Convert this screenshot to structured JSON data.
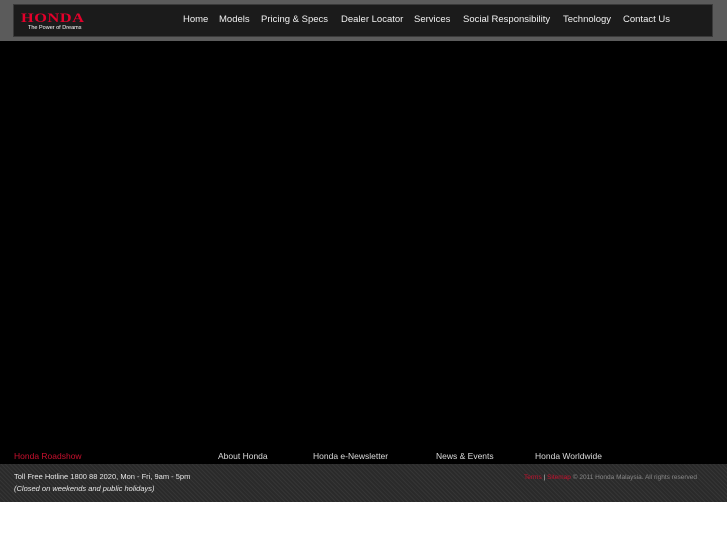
{
  "brand": {
    "name": "HONDA",
    "tagline": "The Power of Dreams",
    "color": "#e4002b"
  },
  "nav": {
    "items": [
      {
        "label": "Home"
      },
      {
        "label": "Models"
      },
      {
        "label": "Pricing & Specs"
      },
      {
        "label": "Dealer Locator"
      },
      {
        "label": "Services"
      },
      {
        "label": "Social Responsibility"
      },
      {
        "label": "Technology"
      },
      {
        "label": "Contact Us"
      }
    ]
  },
  "footer": {
    "links": [
      {
        "label": "Honda Roadshow",
        "active": true
      },
      {
        "label": "About Honda"
      },
      {
        "label": "Honda e-Newsletter"
      },
      {
        "label": "News & Events"
      },
      {
        "label": "Honda Worldwide"
      }
    ],
    "hotline": "Toll Free Hotline 1800 88 2020, Mon - Fri, 9am - 5pm",
    "hours_note": "(Closed on weekends and public holidays)",
    "terms": "Terms",
    "divider": "|",
    "sitemap": "Sitemap",
    "copyright": "© 2011 Honda Malaysia. All rights reserved"
  },
  "colors": {
    "accent_red": "#c8102e",
    "background": "#000000",
    "header_bar": "#5b5b5b"
  }
}
